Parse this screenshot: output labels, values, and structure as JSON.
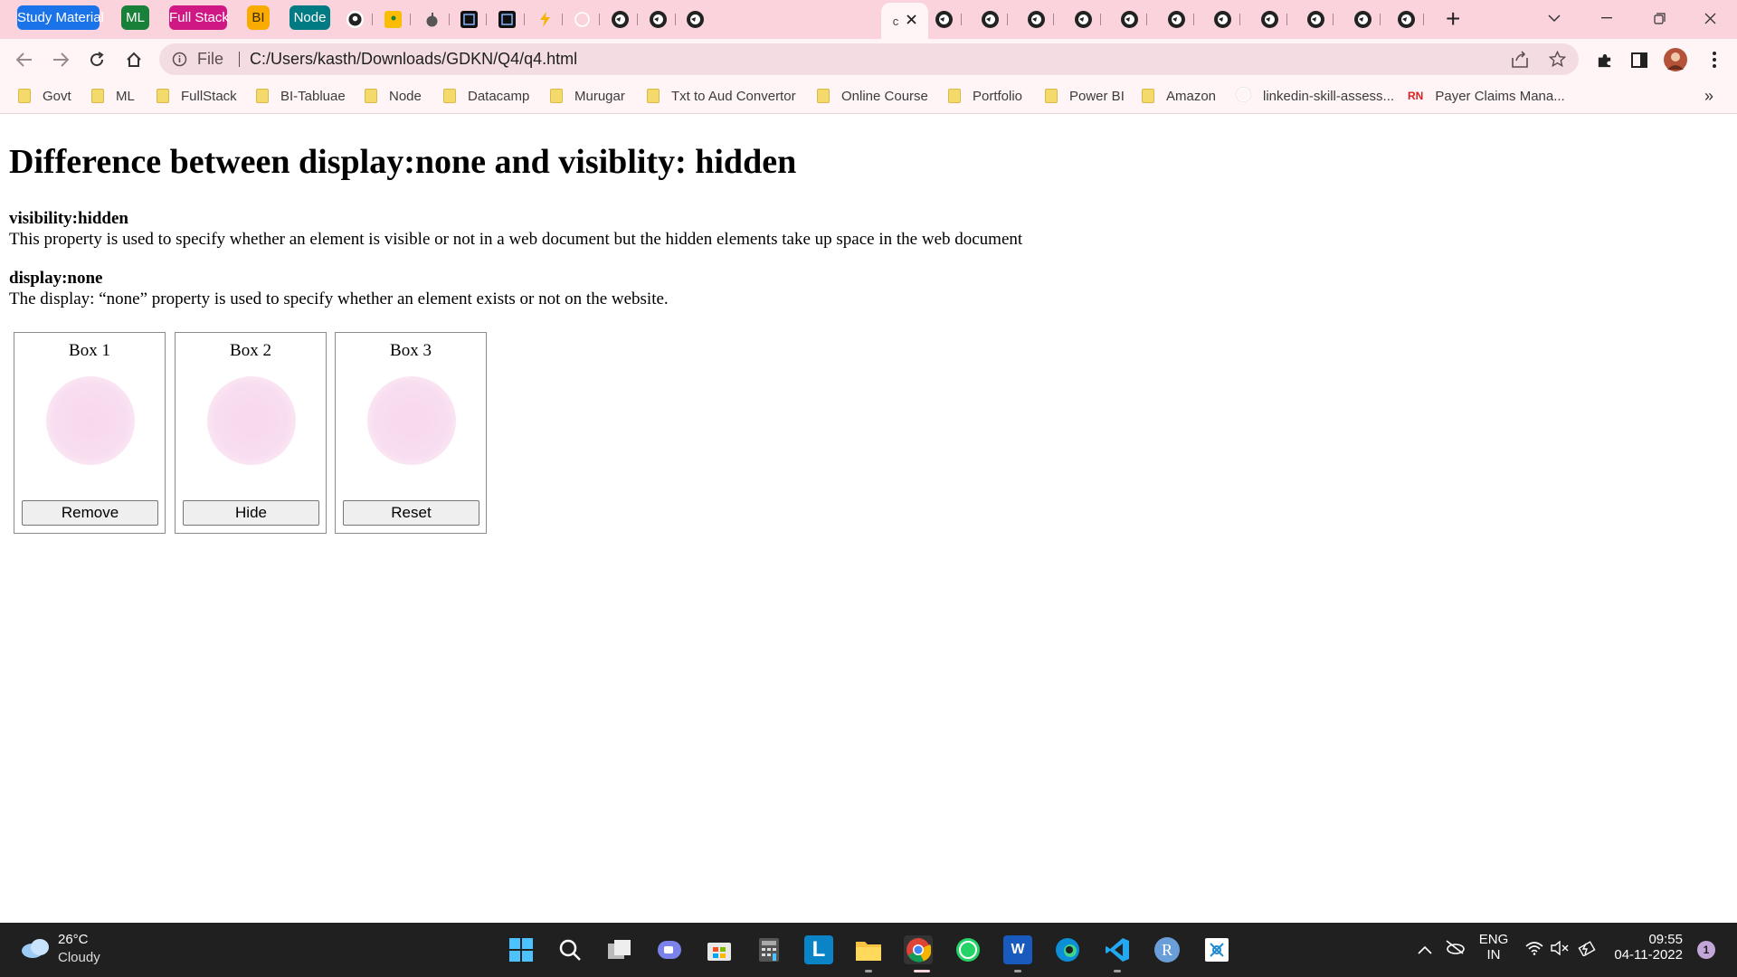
{
  "browser": {
    "tab_groups": [
      {
        "label": "Study Material",
        "color": "#1a73e8"
      },
      {
        "label": "ML",
        "color": "#188038"
      },
      {
        "label": "Full Stack",
        "color": "#d01884"
      },
      {
        "label": "BI",
        "color": "#f9ab00"
      },
      {
        "label": "Node",
        "color": "#007b83"
      }
    ],
    "active_tab_short": "c",
    "new_tab_label": "+",
    "address": {
      "scheme_label": "File",
      "url": "C:/Users/kasth/Downloads/GDKN/Q4/q4.html"
    },
    "bookmarks": [
      "Govt",
      "ML",
      "FullStack",
      "BI-Tabluae",
      "Node",
      "Datacamp",
      "Murugar",
      "Txt to Aud Convertor",
      "Online Course",
      "Portfolio",
      "Power BI",
      "Amazon",
      "linkedin-skill-assess...",
      "Payer Claims Mana..."
    ],
    "bookmarks_overflow": "»",
    "rn_badge": "RN"
  },
  "page": {
    "heading": "Difference between display:none and visiblity: hidden",
    "visibility_title": "visibility:hidden",
    "visibility_desc": "This property is used to specify whether an element is visible or not in a web document but the hidden elements take up space in the web document",
    "display_title": "display:none",
    "display_desc": "The display: “none” property is used to specify whether an element exists or not on the website.",
    "boxes": [
      {
        "title": "Box 1",
        "button": "Remove"
      },
      {
        "title": "Box 2",
        "button": "Hide"
      },
      {
        "title": "Box 3",
        "button": "Reset"
      }
    ],
    "blob_color": "#f8dcef"
  },
  "taskbar": {
    "weather_temp": "26°C",
    "weather_desc": "Cloudy",
    "lang_top": "ENG",
    "lang_bottom": "IN",
    "time": "09:55",
    "date": "04-11-2022",
    "notification_count": "1",
    "r_app_letter": "R",
    "l_app_letter": "L",
    "w_app_letter": "W"
  }
}
